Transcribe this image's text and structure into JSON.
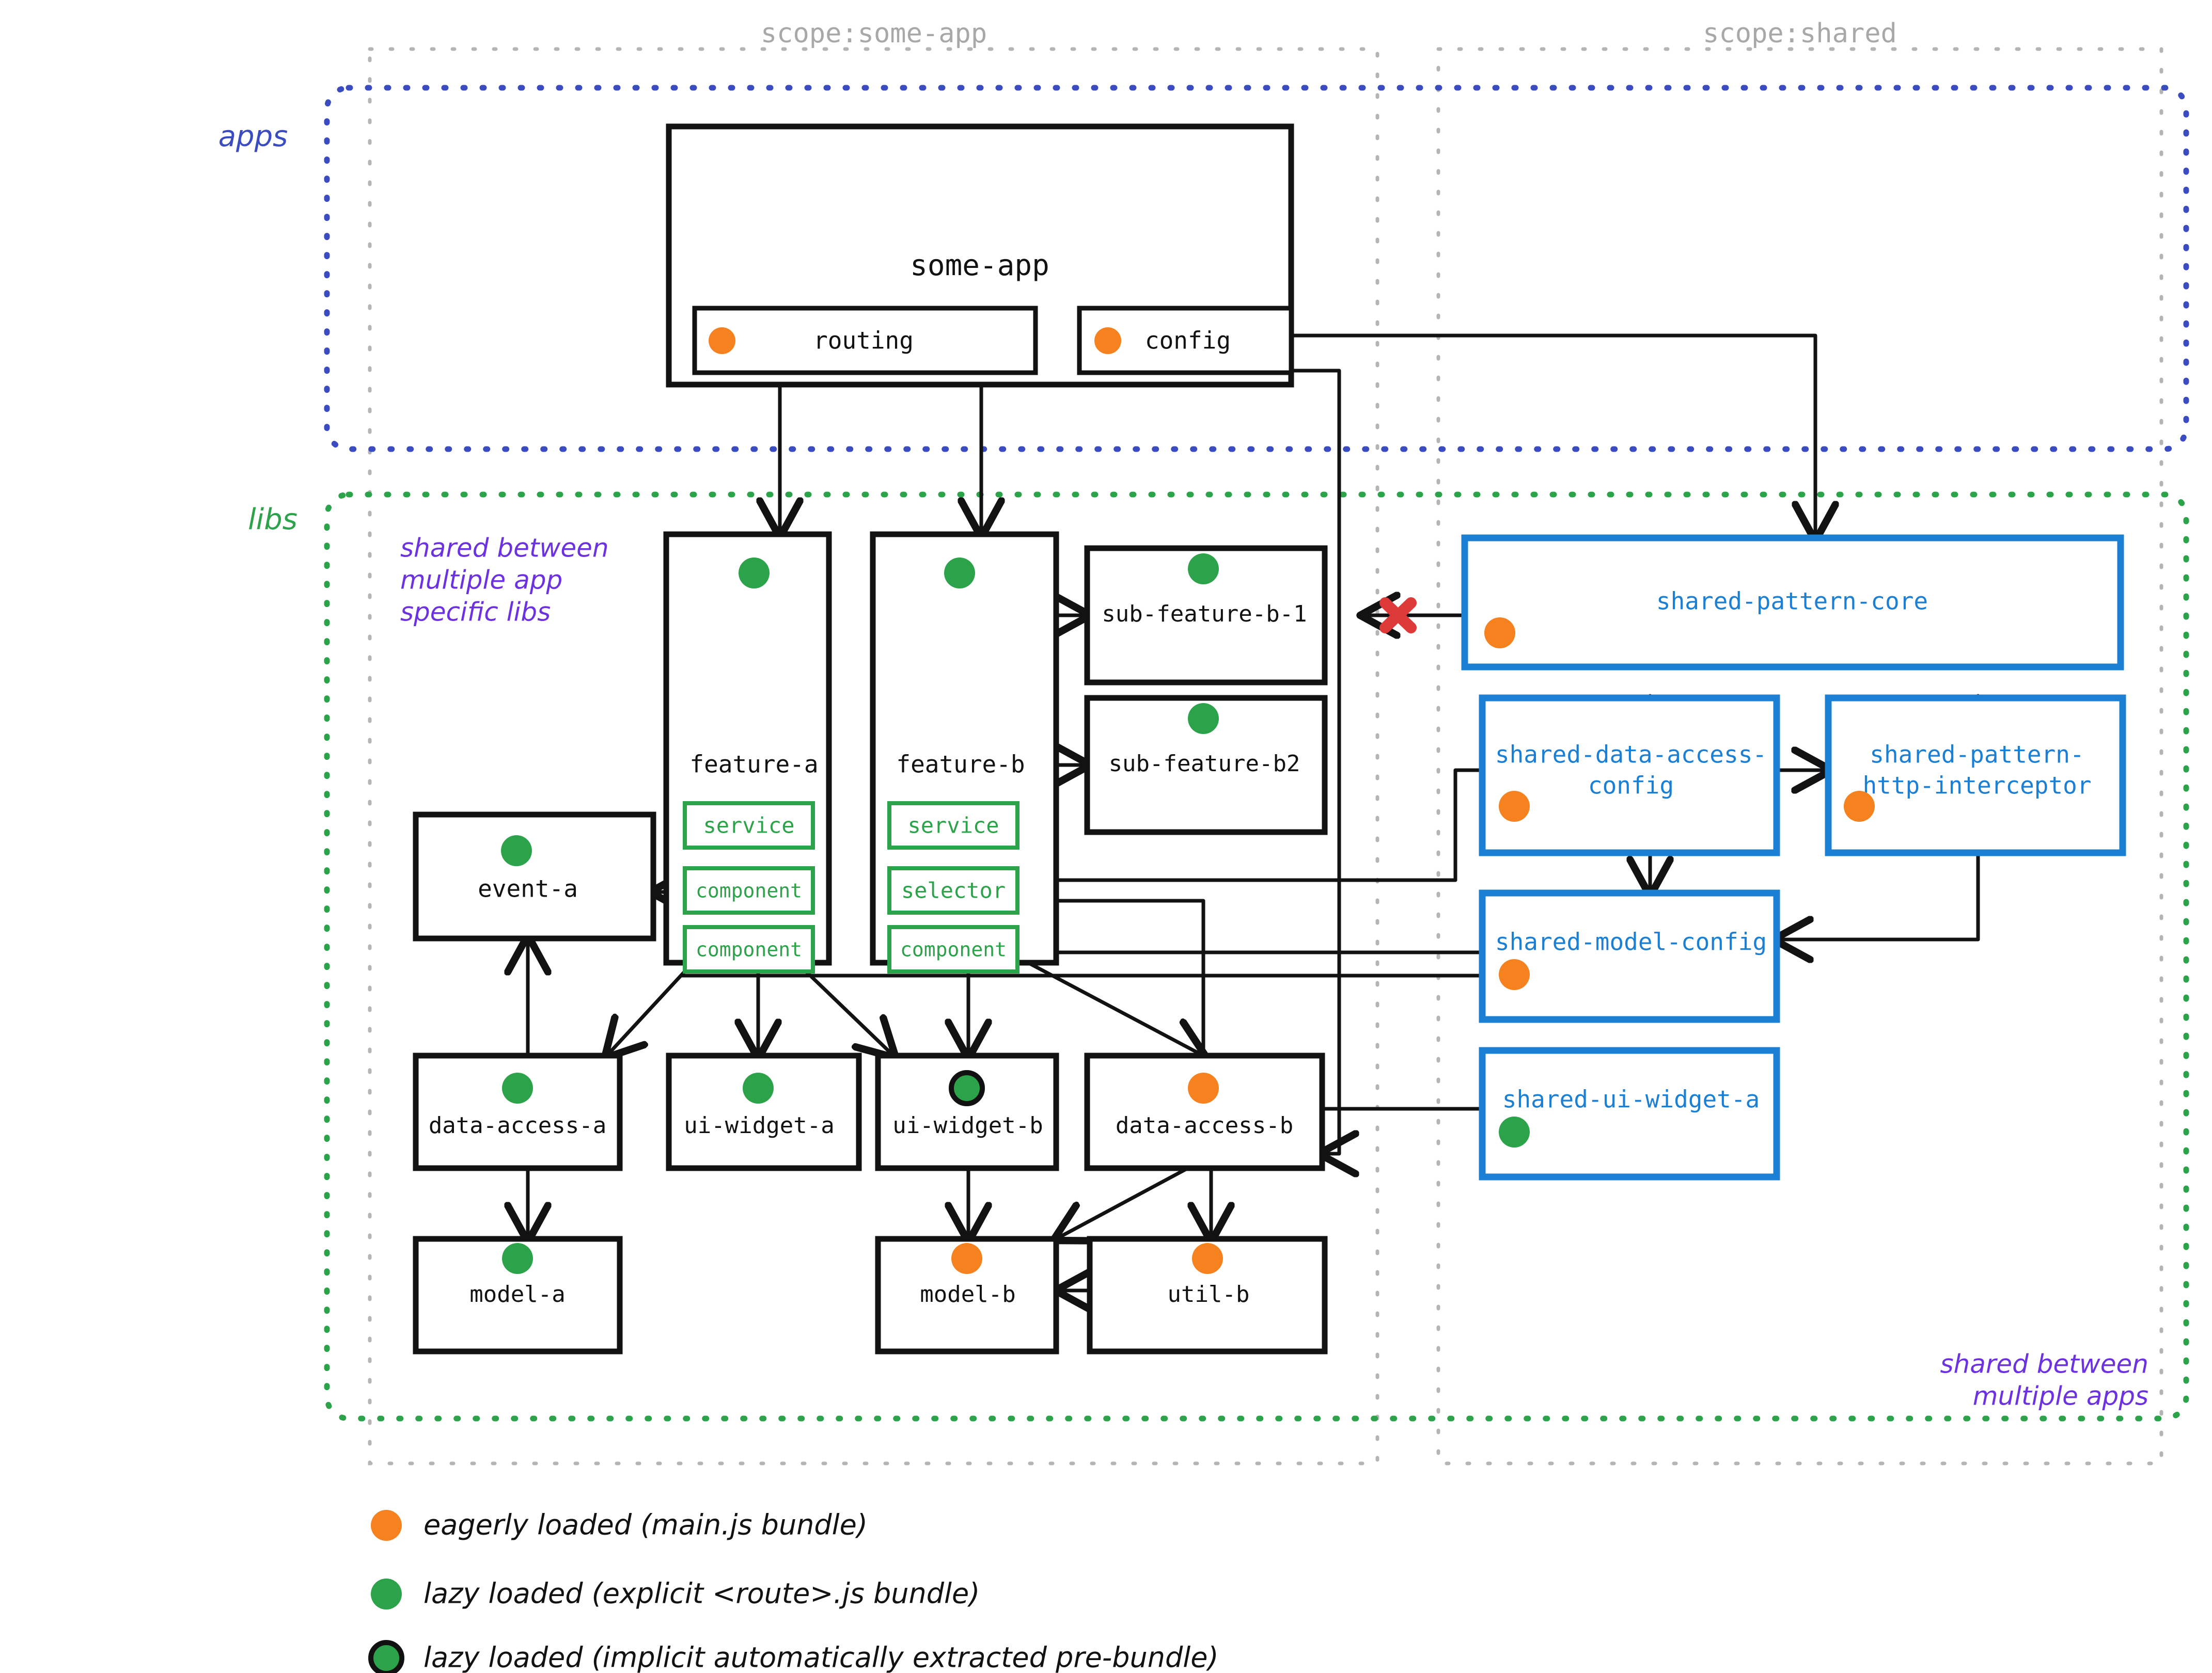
{
  "colors": {
    "eager": "#F5821F",
    "lazy_explicit": "#2CA34A",
    "lazy_implicit_ring": "#111111",
    "shared_blue": "#1b7fd4",
    "apps_border": "#3B4CC0",
    "libs_border": "#2CA34A",
    "scope_border": "#b5b5b5",
    "annotation_purple": "#6D32E0",
    "forbidden_red": "#DE3A3A",
    "box_stroke": "#121212",
    "green_part_stroke": "#2CA34A"
  },
  "scopes": [
    {
      "id": "scope-some-app",
      "label": "scope:some-app"
    },
    {
      "id": "scope-shared",
      "label": "scope:shared"
    }
  ],
  "layers": [
    {
      "id": "apps",
      "label": "apps"
    },
    {
      "id": "libs",
      "label": "libs"
    }
  ],
  "annotations": [
    {
      "id": "note-app-specific",
      "text": [
        "shared between",
        "multiple app",
        "specific libs"
      ]
    },
    {
      "id": "note-shared-apps",
      "text": [
        "shared between",
        "multiple apps"
      ]
    }
  ],
  "forbidden_marker": {
    "id": "forbidden-dependency",
    "glyph": "X"
  },
  "app": {
    "name": "some-app",
    "parts": [
      {
        "name": "routing",
        "bundle": "eager"
      },
      {
        "name": "config",
        "bundle": "eager"
      }
    ]
  },
  "libs": [
    {
      "id": "feature-a",
      "name": "feature-a",
      "bundle": "lazy_explicit",
      "parts": [
        {
          "name": "service",
          "kind": "service"
        },
        {
          "name": "component",
          "kind": "component"
        },
        {
          "name": "component",
          "kind": "component"
        }
      ]
    },
    {
      "id": "feature-b",
      "name": "feature-b",
      "bundle": "lazy_explicit",
      "parts": [
        {
          "name": "service",
          "kind": "service"
        },
        {
          "name": "selector",
          "kind": "selector"
        },
        {
          "name": "component",
          "kind": "component"
        }
      ]
    },
    {
      "id": "sub-feature-b-1",
      "name": "sub-feature-b-1",
      "bundle": "lazy_explicit",
      "parts": []
    },
    {
      "id": "sub-feature-b2",
      "name": "sub-feature-b2",
      "bundle": "lazy_explicit",
      "parts": []
    },
    {
      "id": "event-a",
      "name": "event-a",
      "bundle": "lazy_explicit",
      "parts": []
    },
    {
      "id": "data-access-a",
      "name": "data-access-a",
      "bundle": "lazy_explicit",
      "parts": []
    },
    {
      "id": "ui-widget-a",
      "name": "ui-widget-a",
      "bundle": "lazy_explicit",
      "parts": []
    },
    {
      "id": "ui-widget-b",
      "name": "ui-widget-b",
      "bundle": "lazy_implicit",
      "parts": []
    },
    {
      "id": "data-access-b",
      "name": "data-access-b",
      "bundle": "eager",
      "parts": []
    },
    {
      "id": "model-a",
      "name": "model-a",
      "bundle": "lazy_explicit",
      "parts": []
    },
    {
      "id": "model-b",
      "name": "model-b",
      "bundle": "eager",
      "parts": []
    },
    {
      "id": "util-b",
      "name": "util-b",
      "bundle": "eager",
      "parts": []
    }
  ],
  "shared_libs": [
    {
      "id": "shared-pattern-core",
      "name": "shared-pattern-core",
      "bundle": "eager",
      "lines": [
        "shared-pattern-core"
      ]
    },
    {
      "id": "shared-data-access-config",
      "name": "shared-data-access-config",
      "bundle": "eager",
      "lines": [
        "shared-data-access-",
        "config"
      ]
    },
    {
      "id": "shared-pattern-http-interceptor",
      "name": "shared-pattern-http-interceptor",
      "bundle": "eager",
      "lines": [
        "shared-pattern-",
        "http-interceptor"
      ]
    },
    {
      "id": "shared-model-config",
      "name": "shared-model-config",
      "bundle": "eager",
      "lines": [
        "shared-model-config"
      ]
    },
    {
      "id": "shared-ui-widget-a",
      "name": "shared-ui-widget-a",
      "bundle": "lazy_explicit",
      "lines": [
        "shared-ui-widget-a"
      ]
    }
  ],
  "legend": [
    {
      "id": "legend-eager",
      "marker": "eager",
      "label": "eagerly loaded (main.js bundle)"
    },
    {
      "id": "legend-lazy-explicit",
      "marker": "lazy_explicit",
      "label": "lazy loaded (explicit <route>.js bundle)"
    },
    {
      "id": "legend-lazy-implicit",
      "marker": "lazy_implicit",
      "label": "lazy loaded (implicit automatically extracted pre-bundle)"
    }
  ]
}
